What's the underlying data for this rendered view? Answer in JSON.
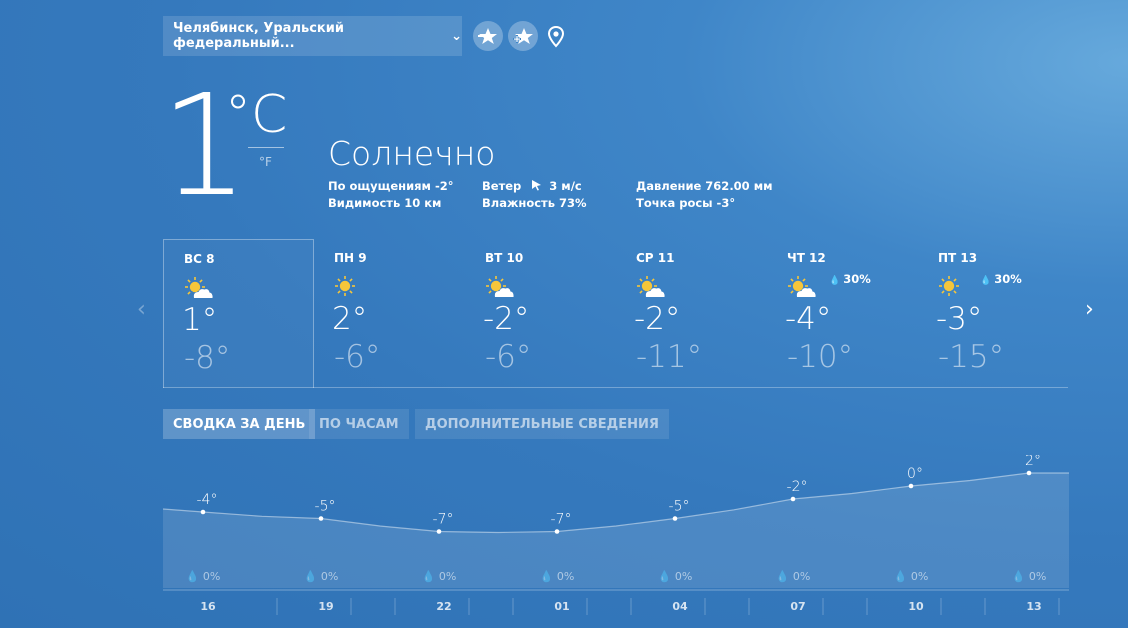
{
  "location": {
    "name": "Челябинск, Уральский федеральный...",
    "chevron": "⌄"
  },
  "current": {
    "temp": "1",
    "unit_c": "°C",
    "unit_f": "°F",
    "condition": "Солнечно",
    "feels_like": "По ощущениям -2°",
    "visibility": "Видимость 10 км",
    "wind_label": "Ветер",
    "wind_value": "3 м/с",
    "humidity": "Влажность 73%",
    "pressure": "Давление 762.00 мм",
    "dew_point": "Точка росы -3°"
  },
  "forecast": [
    {
      "day": "ВС 8",
      "hi": "1°",
      "lo": "-8°",
      "icon": "partly-sunny-icon",
      "precip": ""
    },
    {
      "day": "ПН 9",
      "hi": "2°",
      "lo": "-6°",
      "icon": "sun-icon",
      "precip": ""
    },
    {
      "day": "ВТ 10",
      "hi": "-2°",
      "lo": "-6°",
      "icon": "partly-sunny-icon",
      "precip": ""
    },
    {
      "day": "СР 11",
      "hi": "-2°",
      "lo": "-11°",
      "icon": "partly-sunny-icon",
      "precip": ""
    },
    {
      "day": "ЧТ 12",
      "hi": "-4°",
      "lo": "-10°",
      "icon": "partly-sunny-icon",
      "precip": "30%"
    },
    {
      "day": "ПТ 13",
      "hi": "-3°",
      "lo": "-15°",
      "icon": "sun-icon",
      "precip": "30%"
    }
  ],
  "tabs": [
    "СВОДКА ЗА ДЕНЬ",
    "ПО ЧАСАМ",
    "ДОПОЛНИТЕЛЬНЫЕ СВЕДЕНИЯ"
  ],
  "colors": {
    "accent_sun": "#f6c63a",
    "background": "#3579bd"
  },
  "chart_data": {
    "type": "area",
    "x": [
      "16",
      "19",
      "22",
      "01",
      "04",
      "07",
      "10",
      "13"
    ],
    "values": [
      -4,
      -5,
      -7,
      -7,
      -5,
      -2,
      0,
      2
    ],
    "labels": [
      "-4°",
      "-5°",
      "-7°",
      "-7°",
      "-5°",
      "-2°",
      "0°",
      "2°"
    ],
    "precip": [
      "0%",
      "0%",
      "0%",
      "0%",
      "0%",
      "0%",
      "0%",
      "0%"
    ],
    "grid": false
  }
}
